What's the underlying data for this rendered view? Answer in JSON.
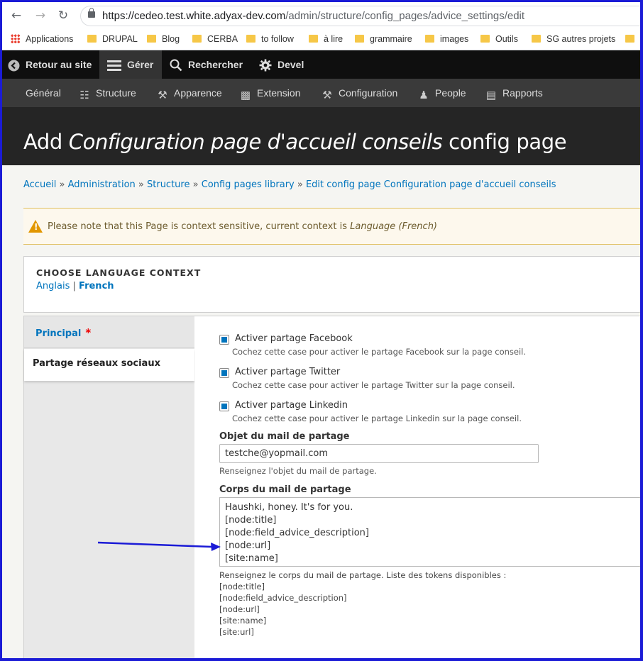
{
  "browser": {
    "url_host": "https://cedeo.test.white.adyax-dev.com",
    "url_path": "/admin/structure/config_pages/advice_settings/edit",
    "bookmarks": [
      "Applications",
      "DRUPAL",
      "Blog",
      "CERBA",
      "to follow",
      "à lire",
      "grammaire",
      "images",
      "Outils",
      "SG autres projets",
      "S"
    ]
  },
  "toolbar": {
    "items": [
      "Retour au site",
      "Gérer",
      "Rechercher",
      "Devel"
    ]
  },
  "tray": {
    "items": [
      "Général",
      "Structure",
      "Apparence",
      "Extension",
      "Configuration",
      "People",
      "Rapports"
    ]
  },
  "header": {
    "title_prefix": "Add ",
    "title_em": "Configuration page d'accueil conseils",
    "title_suffix": " config page"
  },
  "breadcrumb": [
    "Accueil",
    "Administration",
    "Structure",
    "Config pages library",
    "Edit config page Configuration page d'accueil conseils"
  ],
  "warning": {
    "text": "Please note that this Page is context sensitive, current context is ",
    "context": "Language (French)"
  },
  "language_context": {
    "title": "CHOOSE LANGUAGE CONTEXT",
    "links": [
      "Anglais",
      "French"
    ],
    "separator": "|"
  },
  "vertical_tabs": [
    {
      "label": "Principal",
      "required": "*"
    },
    {
      "label": "Partage réseaux sociaux"
    }
  ],
  "form": {
    "checkboxes": [
      {
        "label": "Activer partage Facebook",
        "desc": "Cochez cette case pour activer le partage Facebook sur la page conseil.",
        "checked": true
      },
      {
        "label": "Activer partage Twitter",
        "desc": "Cochez cette case pour activer le partage Twitter sur la page conseil.",
        "checked": true
      },
      {
        "label": "Activer partage Linkedin",
        "desc": "Cochez cette case pour activer le partage Linkedin sur la page conseil.",
        "checked": true
      }
    ],
    "subject": {
      "label": "Objet du mail de partage",
      "value": "testche@yopmail.com",
      "desc": "Renseignez l'objet du mail de partage."
    },
    "body": {
      "label": "Corps du mail de partage",
      "lines": [
        "Haushki, honey. It's for you.",
        "[node:title]",
        "[node:field_advice_description]",
        "[node:url]",
        "[site:name]"
      ],
      "desc": "Renseignez le corps du mail de partage. Liste des tokens disponibles :",
      "tokens": [
        "[node:title]",
        "[node:field_advice_description]",
        "[node:url]",
        "[site:name]",
        "[site:url]"
      ]
    }
  },
  "colors": {
    "link": "#0074bd",
    "annotation_frame": "#1b1bd6",
    "annotation_arrow": "#1b1bd6",
    "toolbar_bg": "#0f0f0f",
    "tray_bg": "#3a3a3a"
  }
}
